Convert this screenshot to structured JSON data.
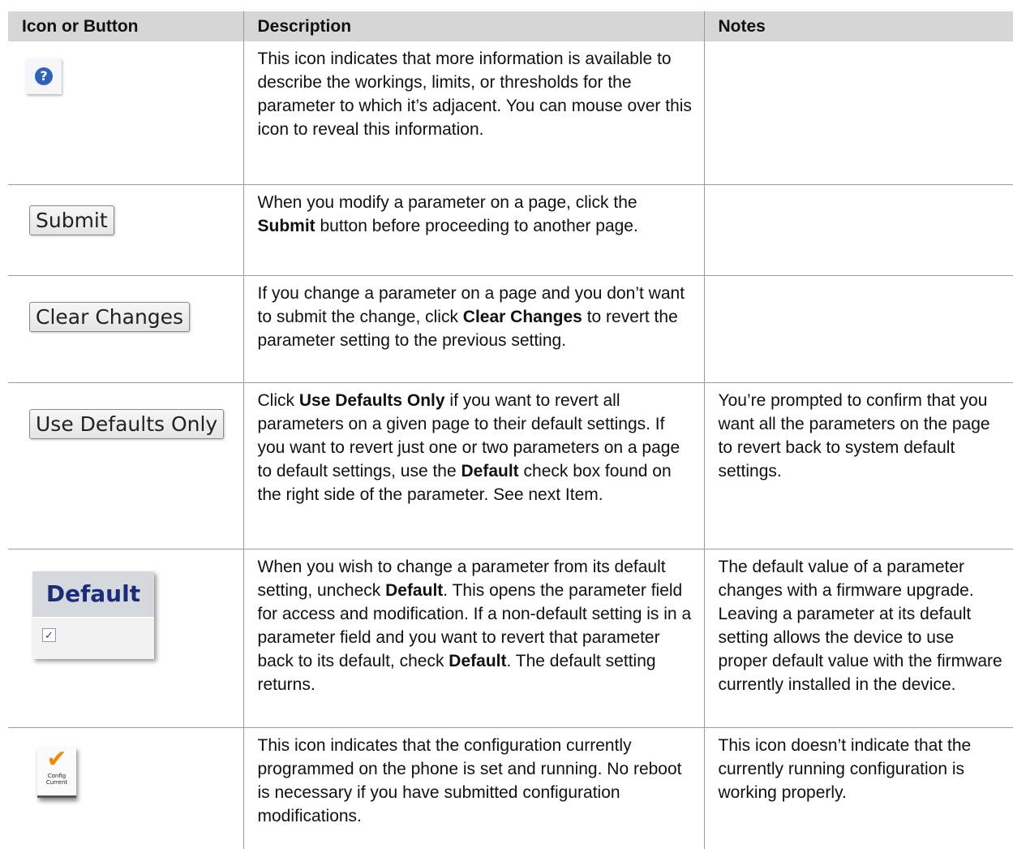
{
  "header": {
    "col1": "Icon or Button",
    "col2": "Description",
    "col3": "Notes"
  },
  "rows": [
    {
      "icon": "help-question-icon",
      "description": "This icon indicates that more information is available to describe the workings, limits, or thresholds for the parameter to which it’s adjacent. You can mouse over this icon to reveal this information.",
      "notes": ""
    },
    {
      "button_label": "Submit",
      "description": {
        "a": "When you modify a parameter on a page, click the ",
        "b": "Submit",
        "c": " button before proceeding to another page."
      },
      "notes": ""
    },
    {
      "button_label": "Clear Changes",
      "description": {
        "a": "If you change a parameter on a page and you don’t want to submit the change, click ",
        "b": "Clear Changes",
        "c": " to revert the parameter setting to the previous setting."
      },
      "notes": ""
    },
    {
      "button_label": "Use Defaults Only",
      "description": {
        "a": "Click ",
        "b": "Use Defaults Only",
        "c": " if you want to revert all parameters on a given page to their default settings. If you want to revert just one or two parameters on a page to default settings, use the ",
        "d": "Default",
        "e": " check box found on the right side of the parameter. See next Item."
      },
      "notes": "You’re prompted to confirm that you want all the parameters on the page to revert back to system default settings."
    },
    {
      "image_label": "Default",
      "checkbox_checked": true,
      "description": {
        "a": "When you wish to change a parameter from its default setting, uncheck ",
        "b": "Default",
        "c": ". This opens the parameter field for access and modification. If a non-default setting is in a parameter field and you want to revert that parameter back to its default, check ",
        "d": "Default",
        "e": ". The default setting returns."
      },
      "notes": "The default value of a parameter changes with a firmware upgrade. Leaving a parameter at its default setting allows the device to use proper default value with the firmware currently installed in the device."
    },
    {
      "icon": "config-current-check-icon",
      "icon_text": {
        "line1": "Config",
        "line2": "Current"
      },
      "description": "This icon indicates that the configuration currently programmed on the phone is set and running. No reboot is necessary if you have submitted configuration modifications.",
      "notes": "This icon doesn’t indicate that the currently running configuration is working properly."
    }
  ],
  "colors": {
    "header_bg": "#d6d6d6",
    "help_icon": "#2f63b8",
    "config_check": "#f08a0b",
    "default_text": "#1c2b7a"
  }
}
